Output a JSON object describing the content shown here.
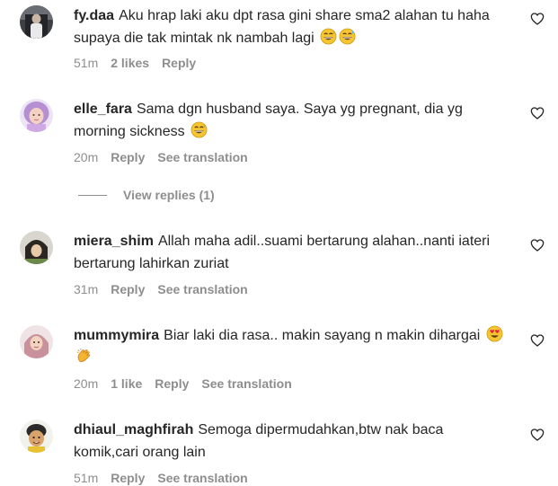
{
  "comments": [
    {
      "username": "fy.daa",
      "text": "Aku hrap laki aku dpt rasa gini share sma2 alahan tu haha supaya die tak mintak nk nambah lagi",
      "emojis": [
        "grinning-sweat-icon",
        "grinning-sweat-icon"
      ],
      "time": "51m",
      "likes": "2 likes",
      "reply": "Reply",
      "see_translation": ""
    },
    {
      "username": "elle_fara",
      "text": "Sama dgn husband saya. Saya yg pregnant, dia yg morning sickness",
      "emojis": [
        "grinning-sweat-icon"
      ],
      "time": "20m",
      "likes": "",
      "reply": "Reply",
      "see_translation": "See translation"
    },
    {
      "username": "miera_shim",
      "text": "Allah maha adil..suami bertarung alahan..nanti iateri bertarung lahirkan zuriat",
      "emojis": [],
      "time": "31m",
      "likes": "",
      "reply": "Reply",
      "see_translation": "See translation"
    },
    {
      "username": "mummymira",
      "text": "Biar laki dia rasa.. makin sayang n makin dihargai",
      "emojis": [
        "heart-eyes-icon",
        "clapping-hands-icon"
      ],
      "time": "20m",
      "likes": "1 like",
      "reply": "Reply",
      "see_translation": "See translation"
    },
    {
      "username": "dhiaul_maghfirah",
      "text": "Semoga dipermudahkan,btw nak baca komik,cari orang lain",
      "emojis": [],
      "time": "51m",
      "likes": "",
      "reply": "Reply",
      "see_translation": "See translation"
    }
  ],
  "view_replies": "View replies (1)",
  "colors": {
    "text": "#262626",
    "meta": "#8e8e8e",
    "background": "#ffffff"
  }
}
